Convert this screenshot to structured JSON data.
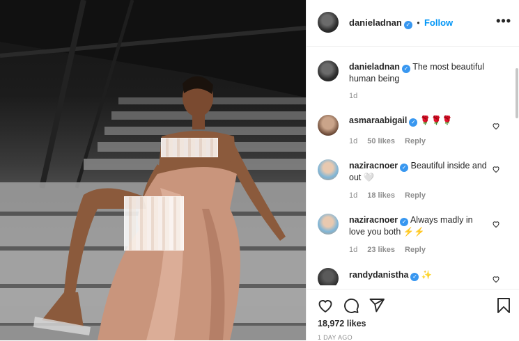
{
  "post": {
    "username": "danieladnan",
    "follow_label": "Follow",
    "more_label": "•••",
    "separator": "•"
  },
  "caption": {
    "username": "danieladnan",
    "text": "The most beautiful human being",
    "age": "1d"
  },
  "comments": [
    {
      "username": "asmaraabigail",
      "text": "🌹🌹🌹",
      "age": "1d",
      "likes": "50 likes",
      "reply": "Reply"
    },
    {
      "username": "naziracnoer",
      "text": "Beautiful inside and out 🤍",
      "age": "1d",
      "likes": "18 likes",
      "reply": "Reply"
    },
    {
      "username": "naziracnoer",
      "text": "Always madly in love you both ⚡⚡",
      "age": "1d",
      "likes": "23 likes",
      "reply": "Reply"
    },
    {
      "username": "randydanistha",
      "text": "✨",
      "age": "",
      "likes": "",
      "reply": ""
    }
  ],
  "footer": {
    "likes": "18,972 likes",
    "timestamp": "1 DAY AGO"
  },
  "icons": {
    "like": "heart-icon",
    "comment": "comment-icon",
    "share": "paper-plane-icon",
    "save": "bookmark-icon",
    "verified": "verified-badge-icon"
  },
  "colors": {
    "accent": "#0095f6",
    "verified": "#3897f0",
    "muted": "#8e8e8e",
    "text": "#262626"
  }
}
